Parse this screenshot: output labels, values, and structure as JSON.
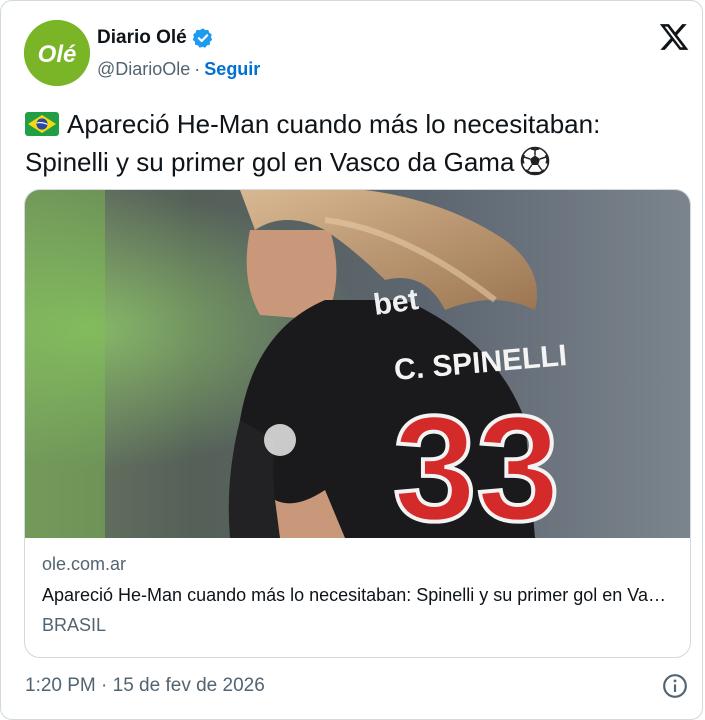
{
  "author": {
    "display_name": "Diario Olé",
    "handle": "@DiarioOle",
    "separator": "·",
    "follow_label": "Seguir",
    "avatar_text": "Olé",
    "verified": true
  },
  "tweet": {
    "flag_icon": "brazil-flag-emoji",
    "text": "Apareció He-Man cuando más lo necesitaban: Spinelli y su primer gol en Vasco da Gama",
    "ball_icon": "soccer-ball-emoji"
  },
  "link_card": {
    "domain": "ole.com.ar",
    "headline": "Apareció He-Man cuando más lo necesitaban: Spinelli y su primer gol en Vasco da Gama",
    "section": "BRASIL",
    "image": {
      "jersey_name": "C. SPINELLI",
      "jersey_number": "33",
      "sponsor_text": "bet"
    }
  },
  "timestamp": "1:20 PM · 15 de fev de 2026",
  "colors": {
    "link_blue": "#006fd6",
    "verified_blue": "#1d9bf0",
    "avatar_green": "#7ab528",
    "muted_text": "#536471"
  }
}
